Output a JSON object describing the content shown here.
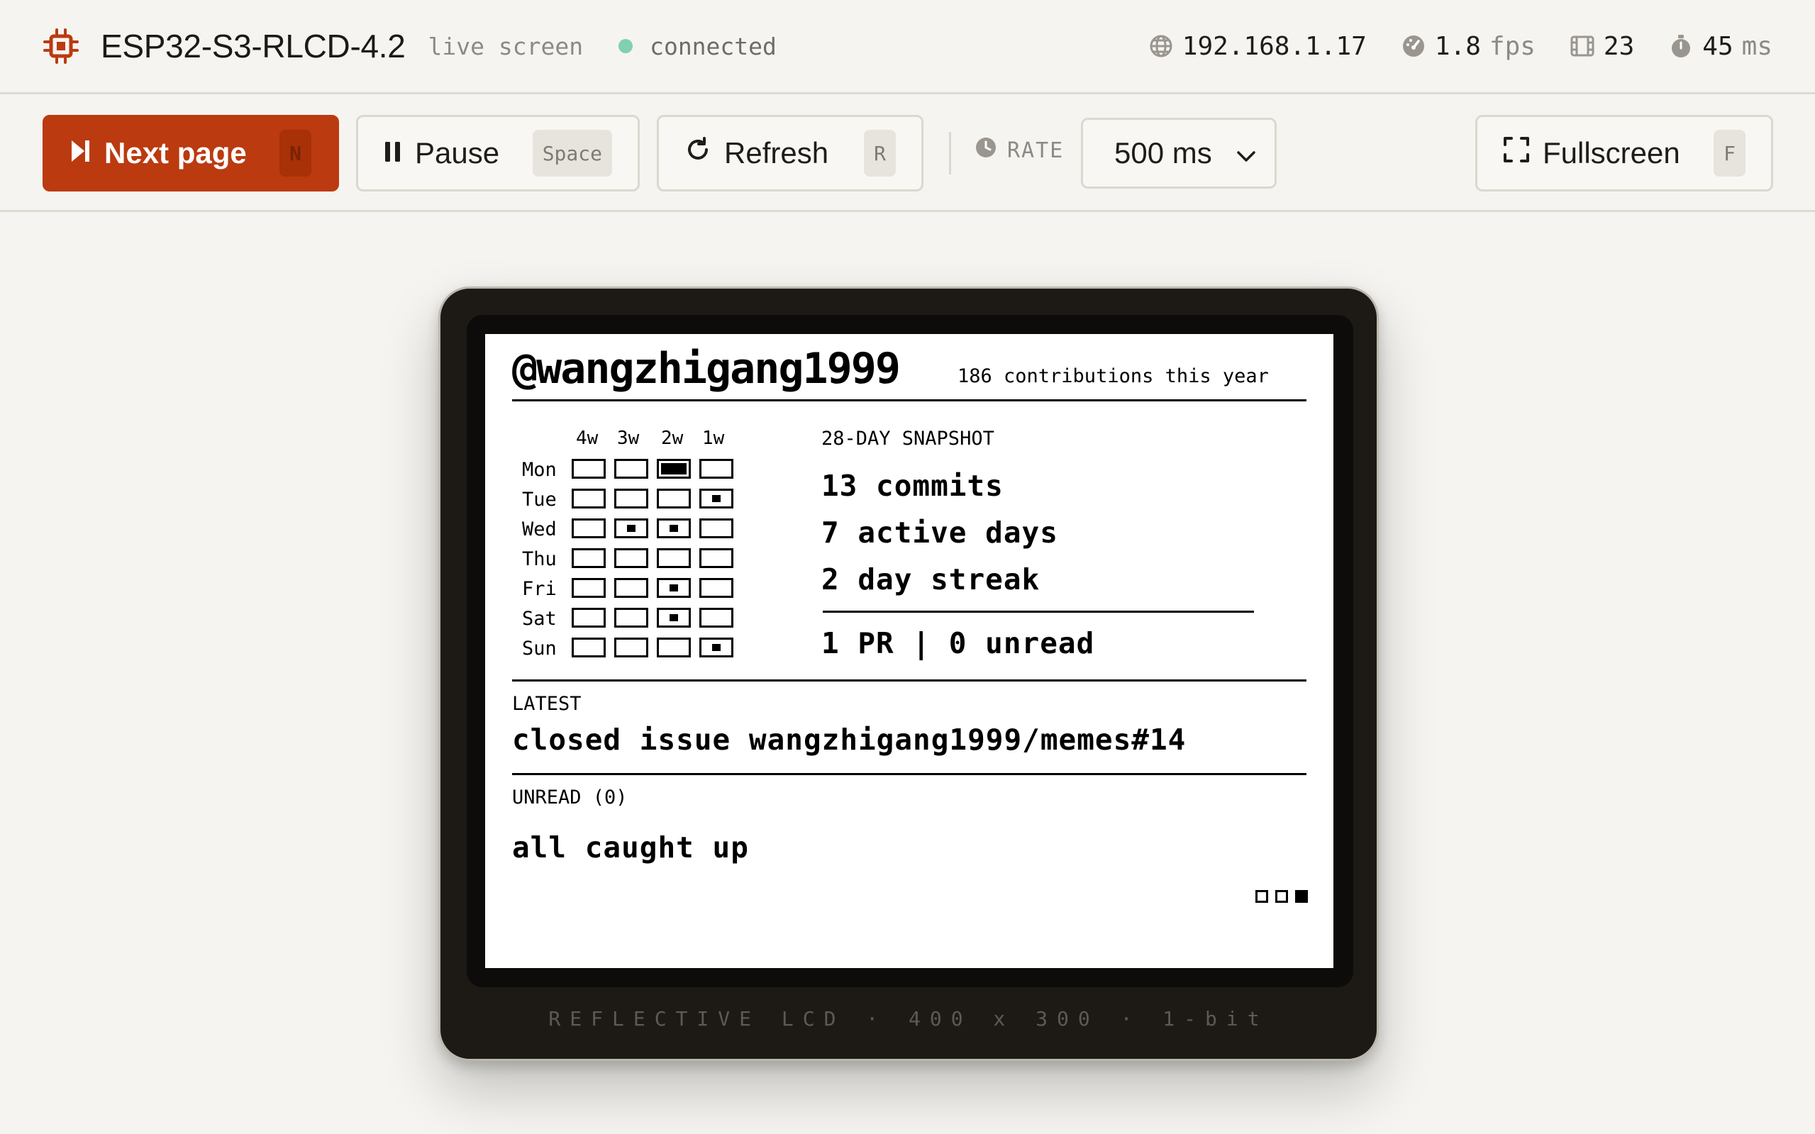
{
  "header": {
    "device_name": "ESP32-S3-RLCD-4.2",
    "live_label": "live screen",
    "status": "connected",
    "status_color": "#7fd1b0",
    "ip": "192.168.1.17",
    "fps_value": "1.8",
    "fps_unit": "fps",
    "frames": "23",
    "latency_value": "45",
    "latency_unit": "ms"
  },
  "toolbar": {
    "next_label": "Next page",
    "next_key": "N",
    "pause_label": "Pause",
    "pause_key": "Space",
    "refresh_label": "Refresh",
    "refresh_key": "R",
    "rate_label": "RATE",
    "rate_value": "500 ms",
    "fullscreen_label": "Fullscreen",
    "fullscreen_key": "F",
    "accent": "#bb3a10"
  },
  "device": {
    "caption": "REFLECTIVE LCD · 400 x 300 · 1-bit"
  },
  "screen": {
    "username": "@wangzhigang1999",
    "contributions": "186 contributions this year",
    "week_labels": [
      "4w",
      "3w",
      "2w",
      "1w"
    ],
    "days": [
      "Mon",
      "Tue",
      "Wed",
      "Thu",
      "Fri",
      "Sat",
      "Sun"
    ],
    "grid_levels": [
      [
        0,
        0,
        2,
        0
      ],
      [
        0,
        0,
        0,
        1
      ],
      [
        0,
        1,
        1,
        0
      ],
      [
        0,
        0,
        0,
        0
      ],
      [
        0,
        0,
        1,
        0
      ],
      [
        0,
        0,
        1,
        0
      ],
      [
        0,
        0,
        0,
        1
      ]
    ],
    "snapshot_title": "28-DAY SNAPSHOT",
    "commits": "13 commits",
    "active_days": "7 active days",
    "streak": "2 day streak",
    "pr_unread": "1 PR | 0 unread",
    "latest_label": "LATEST",
    "latest_text": "closed issue wangzhigang1999/memes#14",
    "unread_label": "UNREAD (0)",
    "unread_text": "all caught up",
    "page_count": 3,
    "active_page": 3
  }
}
